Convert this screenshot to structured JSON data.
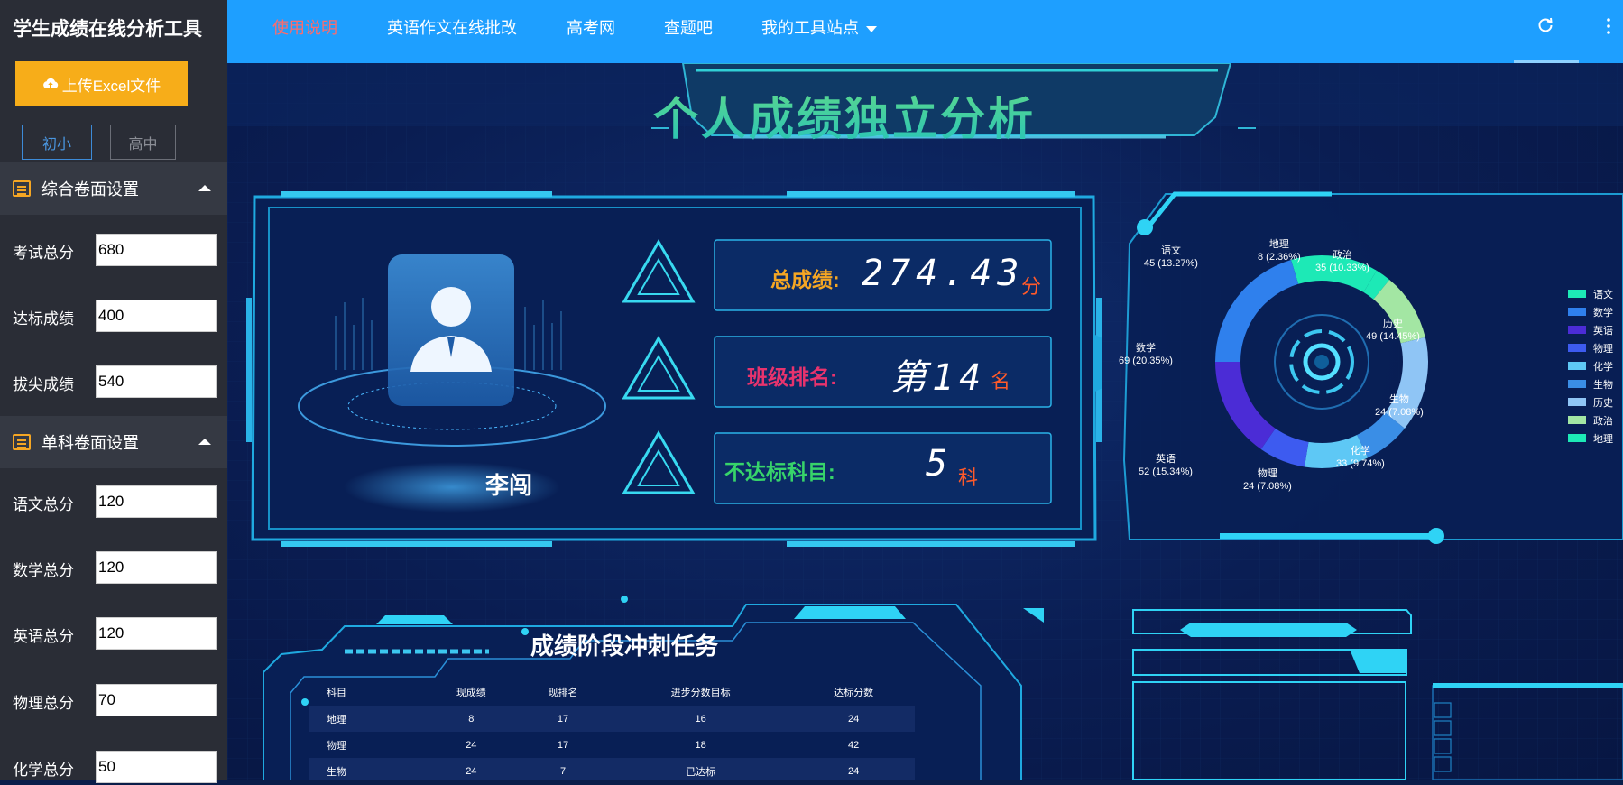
{
  "sidebar": {
    "title": "学生成绩在线分析工具",
    "upload_label": "上传Excel文件",
    "levels": [
      "初小",
      "高中"
    ],
    "sections": [
      {
        "title": "综合卷面设置",
        "fields": [
          {
            "label": "考试总分",
            "value": "680"
          },
          {
            "label": "达标成绩",
            "value": "400"
          },
          {
            "label": "拔尖成绩",
            "value": "540"
          }
        ]
      },
      {
        "title": "单科卷面设置",
        "fields": [
          {
            "label": "语文总分",
            "value": "120"
          },
          {
            "label": "数学总分",
            "value": "120"
          },
          {
            "label": "英语总分",
            "value": "120"
          },
          {
            "label": "物理总分",
            "value": "70"
          },
          {
            "label": "化学总分",
            "value": "50"
          }
        ]
      }
    ]
  },
  "nav": {
    "items": [
      "使用说明",
      "英语作文在线批改",
      "高考网",
      "查题吧",
      "我的工具站点"
    ],
    "active_index": 0
  },
  "dashboard": {
    "title": "个人成绩独立分析",
    "student_name": "李闯",
    "stats": [
      {
        "label": "总成绩:",
        "value": "274.43",
        "unit": "分",
        "color": "#f5a623"
      },
      {
        "label": "班级排名:",
        "value": "第14",
        "unit": "名",
        "color": "#e8336d"
      },
      {
        "label": "不达标科目:",
        "value": "5",
        "unit": "科",
        "color": "#37d46a"
      }
    ],
    "pie_labels": [
      {
        "name": "语文",
        "detail": "45 (13.27%)"
      },
      {
        "name": "地理",
        "detail": "8 (2.36%)"
      },
      {
        "name": "政治",
        "detail": "35 (10.33%)"
      },
      {
        "name": "历史",
        "detail": "49 (14.45%)"
      },
      {
        "name": "数学",
        "detail": "69 (20.35%)"
      },
      {
        "name": "生物",
        "detail": "24 (7.08%)"
      },
      {
        "name": "化学",
        "detail": "33 (9.74%)"
      },
      {
        "name": "英语",
        "detail": "52 (15.34%)"
      },
      {
        "name": "物理",
        "detail": "24 (7.08%)"
      }
    ],
    "task_title": "成绩阶段冲刺任务",
    "task_table": {
      "headers": [
        "科目",
        "现成绩",
        "现排名",
        "进步分数目标",
        "达标分数"
      ],
      "rows": [
        [
          "地理",
          "8",
          "17",
          "16",
          "24"
        ],
        [
          "物理",
          "24",
          "17",
          "18",
          "42"
        ],
        [
          "生物",
          "24",
          "7",
          "已达标",
          "24"
        ]
      ]
    }
  },
  "chart_data": {
    "type": "pie",
    "style": "donut",
    "legend_position": "right",
    "slices": [
      {
        "name": "语文",
        "value": 45,
        "percent": 13.27,
        "color": "#1de9b6"
      },
      {
        "name": "数学",
        "value": 69,
        "percent": 20.35,
        "color": "#2f80ed"
      },
      {
        "name": "英语",
        "value": 52,
        "percent": 15.34,
        "color": "#4b2cd6"
      },
      {
        "name": "物理",
        "value": 24,
        "percent": 7.08,
        "color": "#3d5bf0"
      },
      {
        "name": "化学",
        "value": 33,
        "percent": 9.74,
        "color": "#5ec8f5"
      },
      {
        "name": "生物",
        "value": 24,
        "percent": 7.08,
        "color": "#3a8ee6"
      },
      {
        "name": "历史",
        "value": 49,
        "percent": 14.45,
        "color": "#8fc5f5"
      },
      {
        "name": "政治",
        "value": 35,
        "percent": 10.33,
        "color": "#a3e6a3"
      },
      {
        "name": "地理",
        "value": 8,
        "percent": 2.36,
        "color": "#1de9b6"
      }
    ]
  }
}
